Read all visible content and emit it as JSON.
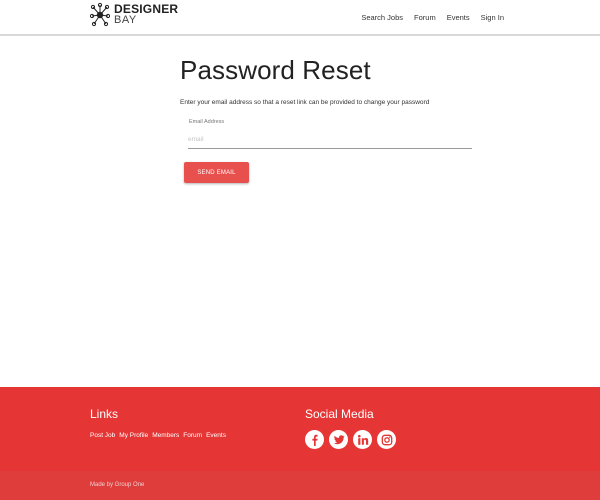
{
  "header": {
    "logo_line1": "DESIGNER",
    "logo_line2": "BAY",
    "nav": [
      "Search Jobs",
      "Forum",
      "Events",
      "Sign In"
    ]
  },
  "main": {
    "title": "Password Reset",
    "intro": "Enter your email address so that a reset link can be provided to change your password",
    "email_label": "Email Address",
    "email_placeholder": "email",
    "email_value": "",
    "send_button": "SEND EMAIL"
  },
  "footer": {
    "links_heading": "Links",
    "links": [
      "Post Job",
      "My Profile",
      "Members",
      "Forum",
      "Events"
    ],
    "social_heading": "Social Media",
    "social_icons": [
      "facebook-icon",
      "twitter-icon",
      "linkedin-icon",
      "instagram-icon"
    ],
    "copyright": "Made by Group One"
  },
  "colors": {
    "accent": "#e53635",
    "button": "#e8504e",
    "footer_bottom": "#de3d3c"
  }
}
